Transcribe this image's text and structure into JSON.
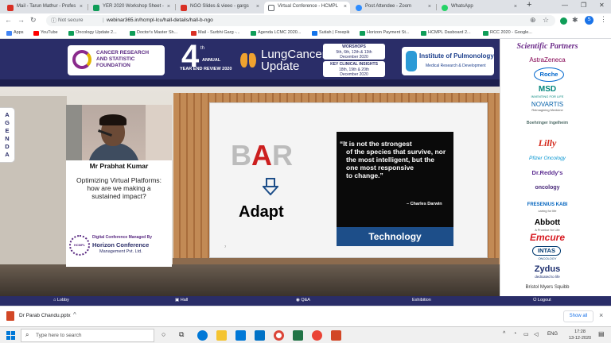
{
  "browser": {
    "tabs": [
      {
        "label": "Mail - Tarun Mathur - Profes",
        "color": "#d93025"
      },
      {
        "label": "YER 2020 Workshop Sheet -",
        "color": "#0f9d58"
      },
      {
        "label": "NGO Slides & vieeo - gargs",
        "color": "#d93025"
      },
      {
        "label": "Virtual Conference - HCMPL",
        "color": "#5f6368"
      },
      {
        "label": "Post Attendee - Zoom",
        "color": "#2d8cff"
      },
      {
        "label": "WhatsApp",
        "color": "#25d366"
      }
    ],
    "new_tab": "+",
    "url_security": "Not secure",
    "url": "webinar365.in/hcmpl-lcu/hall-details/hall-b-ngo",
    "profile_initial": "S",
    "bookmarks": [
      {
        "label": "Apps",
        "color": "#4285f4"
      },
      {
        "label": "YouTube",
        "color": "#ff0000"
      },
      {
        "label": "Oncology Update 2...",
        "color": "#0f9d58"
      },
      {
        "label": "Doctor's Master Sh...",
        "color": "#0f9d58"
      },
      {
        "label": "Mail - Surbhi Garg -...",
        "color": "#d93025"
      },
      {
        "label": "Agenda LCMC 2020...",
        "color": "#0f9d58"
      },
      {
        "label": "Sutiah | Freepik",
        "color": "#1273eb"
      },
      {
        "label": "Horizon Payment St...",
        "color": "#0f9d58"
      },
      {
        "label": "HCMPL Dasboard 2...",
        "color": "#0f9d58"
      },
      {
        "label": "RCC 2020 - Google...",
        "color": "#0f9d58"
      }
    ]
  },
  "banner": {
    "crsf_line1": "CANCER RESEARCH",
    "crsf_line2": "AND STATISTIC",
    "crsf_line3": "FOUNDATION",
    "edition_number": "4",
    "edition_sup": "th",
    "annual": "ANNUAL",
    "year_end": "YEAR END REVIEW 2020",
    "title_line1": "LungCancer",
    "title_line2": "Update",
    "workshops_label": "WORSHOPS",
    "workshops_dates": "5th, 6th, 12th & 13th",
    "workshops_month": "December 2020",
    "insights_label": "KEY CLINICAL INSIGHTS",
    "insights_dates": "18th, 19th & 20th",
    "insights_month": "December 2020",
    "ip_name": "Institute of Pulmonology",
    "ip_sub": "Medical Research & Development"
  },
  "agenda_label": "AGENDA",
  "speaker": {
    "name": "Mr Prabhat Kumar",
    "talk_line1": "Optimizing Virtual Platforms:",
    "talk_line2": "how are we making a",
    "talk_line3": "sustained impact?",
    "managed_by": "Digital Conference Managed By",
    "company_line1": "Horizon Conference",
    "company_line2": "Management Pvt. Ltd.",
    "badge": "HCMPL"
  },
  "slide": {
    "bar_b": "B",
    "bar_a": "A",
    "bar_r": "R",
    "adapt": "Adapt",
    "quote_line1": "“It is not the strongest",
    "quote_line2": "of the species that survive, nor",
    "quote_line3": "the most intelligent, but the",
    "quote_line4": "one most responsive",
    "quote_line5": "to change.”",
    "author": "–  Charles Darwin",
    "technology": "Technology",
    "page_number": "7"
  },
  "partners": {
    "heading": "Scientific Partners",
    "items": [
      {
        "label": "AstraZeneca",
        "color": "#830051"
      },
      {
        "label": "Roche",
        "color": "#0066cc"
      },
      {
        "label": "MSD",
        "color": "#00857c"
      },
      {
        "label": "NOVARTIS",
        "color": "#e87722"
      },
      {
        "label": "Boehringer Ingelheim",
        "color": "#08312a"
      },
      {
        "label": "Lilly",
        "color": "#d52b1e"
      },
      {
        "label": "Pfizer Oncology",
        "color": "#0093d0"
      },
      {
        "label": "Dr.Reddy's",
        "color": "#5c2d91"
      },
      {
        "label": "oncology",
        "color": "#4a2a7a"
      },
      {
        "label": "FRESENIUS KABI",
        "color": "#0063be"
      },
      {
        "label": "Abbott",
        "color": "#009cde"
      },
      {
        "label": "Emcure",
        "color": "#d71920"
      },
      {
        "label": "INTAS",
        "color": "#003a70"
      },
      {
        "label": "Zydus",
        "color": "#1d2f6f"
      },
      {
        "label": "Bristol Myers Squibb",
        "color": "#be2bbb"
      }
    ],
    "msd_sub": "INVENTING FOR LIFE",
    "novartis_sub": "Reimagining Medicine",
    "pfizer_sub": "Oncology",
    "fresenius_sub": "caring for life",
    "abbott_sub": "A Promise for Life",
    "intas_sub": "ONCOLOGY",
    "zydus_sub": "dedicated to life",
    "astra_sub": ""
  },
  "bottom_nav": {
    "lobby": "Lobby",
    "hall": "Hall",
    "qa": "Q&A",
    "exhibition": "Exhibition",
    "logout": "Logout"
  },
  "download": {
    "filename": "Dr Parab Chandu.pptx",
    "show_all": "Show all"
  },
  "taskbar": {
    "search_placeholder": "Type here to search",
    "lang": "ENG",
    "time": "17:28",
    "date": "13-12-2020"
  }
}
